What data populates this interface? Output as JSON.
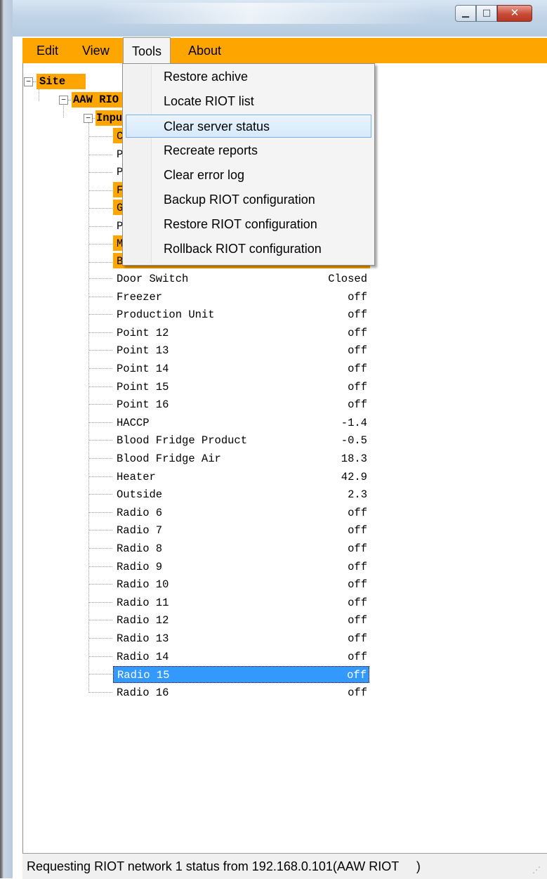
{
  "menu": {
    "items": [
      "Edit",
      "View",
      "Tools",
      "About"
    ],
    "open_menu": "Tools"
  },
  "tools_menu": {
    "items": [
      "Restore achive",
      "Locate RIOT list",
      "Clear server status",
      "Recreate reports",
      "Clear error log",
      "Backup RIOT configuration",
      "Restore RIOT configuration",
      "Rollback RIOT configuration"
    ],
    "highlighted": "Clear server status"
  },
  "tree": {
    "root": "Site",
    "node": "AAW RIO",
    "group": "Inpu",
    "hidden_prefixes": [
      "C",
      "P",
      "P",
      "F",
      "G",
      "P",
      "M",
      "B"
    ],
    "rows": [
      {
        "label": "Door Switch",
        "value": "Closed"
      },
      {
        "label": "Freezer",
        "value": "off"
      },
      {
        "label": "Production Unit",
        "value": "off"
      },
      {
        "label": "Point 12",
        "value": "off"
      },
      {
        "label": "Point 13",
        "value": "off"
      },
      {
        "label": "Point 14",
        "value": "off"
      },
      {
        "label": "Point 15",
        "value": "off"
      },
      {
        "label": "Point 16",
        "value": "off"
      },
      {
        "label": "HACCP",
        "value": "-1.4"
      },
      {
        "label": "Blood Fridge Product",
        "value": "-0.5"
      },
      {
        "label": "Blood Fridge Air",
        "value": "18.3"
      },
      {
        "label": "Heater",
        "value": "42.9"
      },
      {
        "label": "Outside",
        "value": "2.3"
      },
      {
        "label": "Radio 6",
        "value": "off"
      },
      {
        "label": "Radio 7",
        "value": "off"
      },
      {
        "label": "Radio 8",
        "value": "off"
      },
      {
        "label": "Radio 9",
        "value": "off"
      },
      {
        "label": "Radio 10",
        "value": "off"
      },
      {
        "label": "Radio 11",
        "value": "off"
      },
      {
        "label": "Radio 12",
        "value": "off"
      },
      {
        "label": "Radio 13",
        "value": "off"
      },
      {
        "label": "Radio 14",
        "value": "off"
      },
      {
        "label": "Radio 15",
        "value": "off"
      },
      {
        "label": "Radio 16",
        "value": "off"
      }
    ],
    "selected": "Radio 15"
  },
  "status_bar": {
    "text": "Requesting RIOT network 1 status from 192.168.0.101(AAW RIOT     )"
  },
  "colors": {
    "accent": "#ffa500",
    "selection": "#3399ff",
    "menu_hover": "#d6e9fb"
  },
  "icons": {
    "minimize": "minimize-icon",
    "maximize": "maximize-icon",
    "close": "close-icon",
    "expander": "collapse-minus-icon",
    "grip": "resize-grip-icon"
  }
}
